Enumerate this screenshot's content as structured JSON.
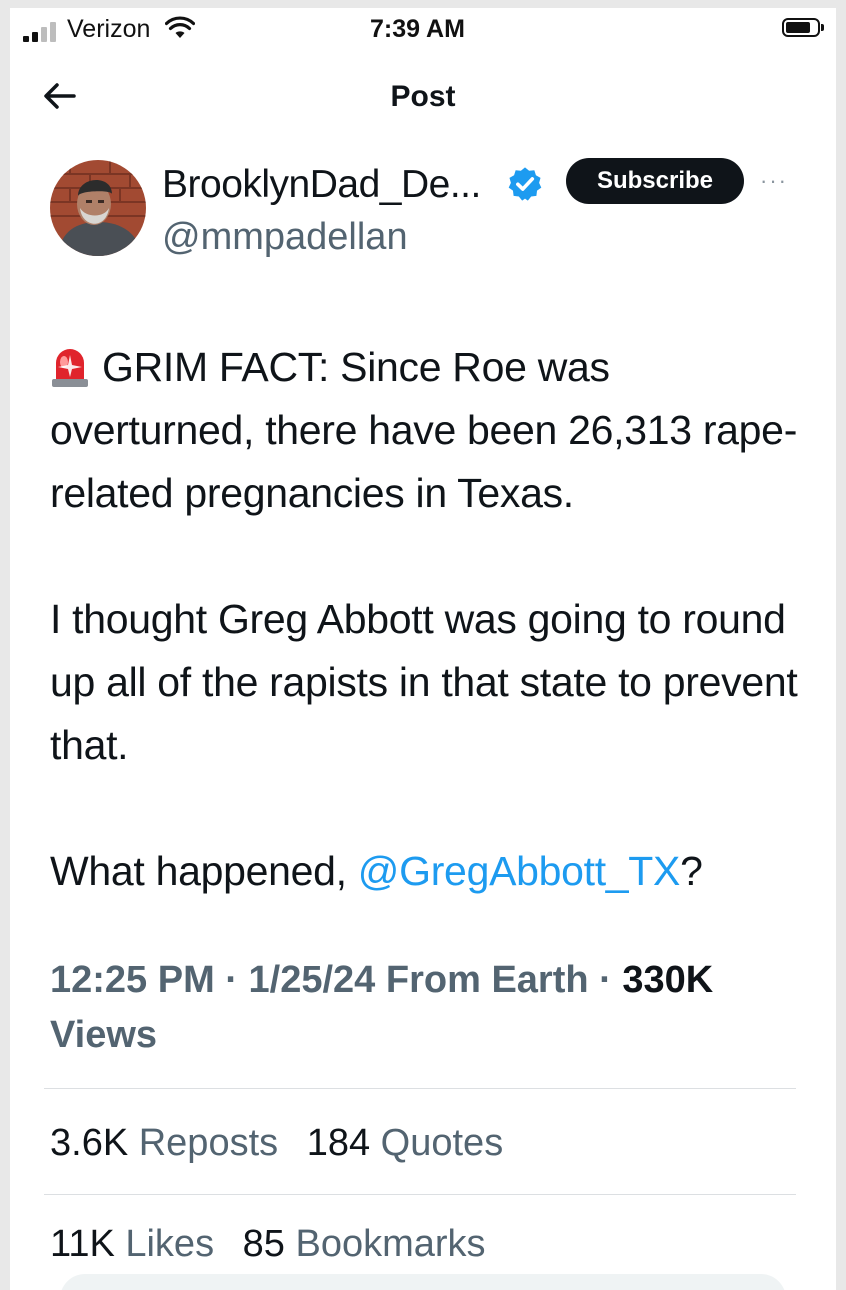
{
  "status_bar": {
    "carrier": "Verizon",
    "time": "7:39 AM"
  },
  "nav": {
    "title": "Post",
    "back_icon": "arrow-left-icon"
  },
  "author": {
    "display_name": "BrooklynDad_De...",
    "handle": "@mmpadellan",
    "verified_icon": "verified-badge-icon",
    "verified_color": "#1d9bf0"
  },
  "actions": {
    "subscribe_label": "Subscribe",
    "more_label": "···"
  },
  "tweet": {
    "emoji_icon": "police-light-icon",
    "paragraph1": "GRIM FACT: Since Roe was overturned, there have been 26,313 rape-related pregnancies in Texas.",
    "paragraph2": "I thought Greg Abbott was going to round up all of the rapists in that state to prevent that.",
    "paragraph3_prefix": "What happened, ",
    "mention": "@GregAbbott_TX",
    "paragraph3_suffix": "?"
  },
  "meta": {
    "time": "12:25 PM",
    "sep1": " · ",
    "date": "1/25/24",
    "source": " From Earth",
    "sep2": " · ",
    "views_count": "330K",
    "views_label": "Views"
  },
  "stats": {
    "reposts_count": "3.6K",
    "reposts_label": "Reposts",
    "quotes_count": "184",
    "quotes_label": "Quotes",
    "likes_count": "11K",
    "likes_label": "Likes",
    "bookmarks_count": "85",
    "bookmarks_label": "Bookmarks"
  },
  "colors": {
    "text": "#0f1419",
    "secondary": "#536471",
    "link": "#1d9bf0",
    "button_bg": "#0f1419"
  }
}
